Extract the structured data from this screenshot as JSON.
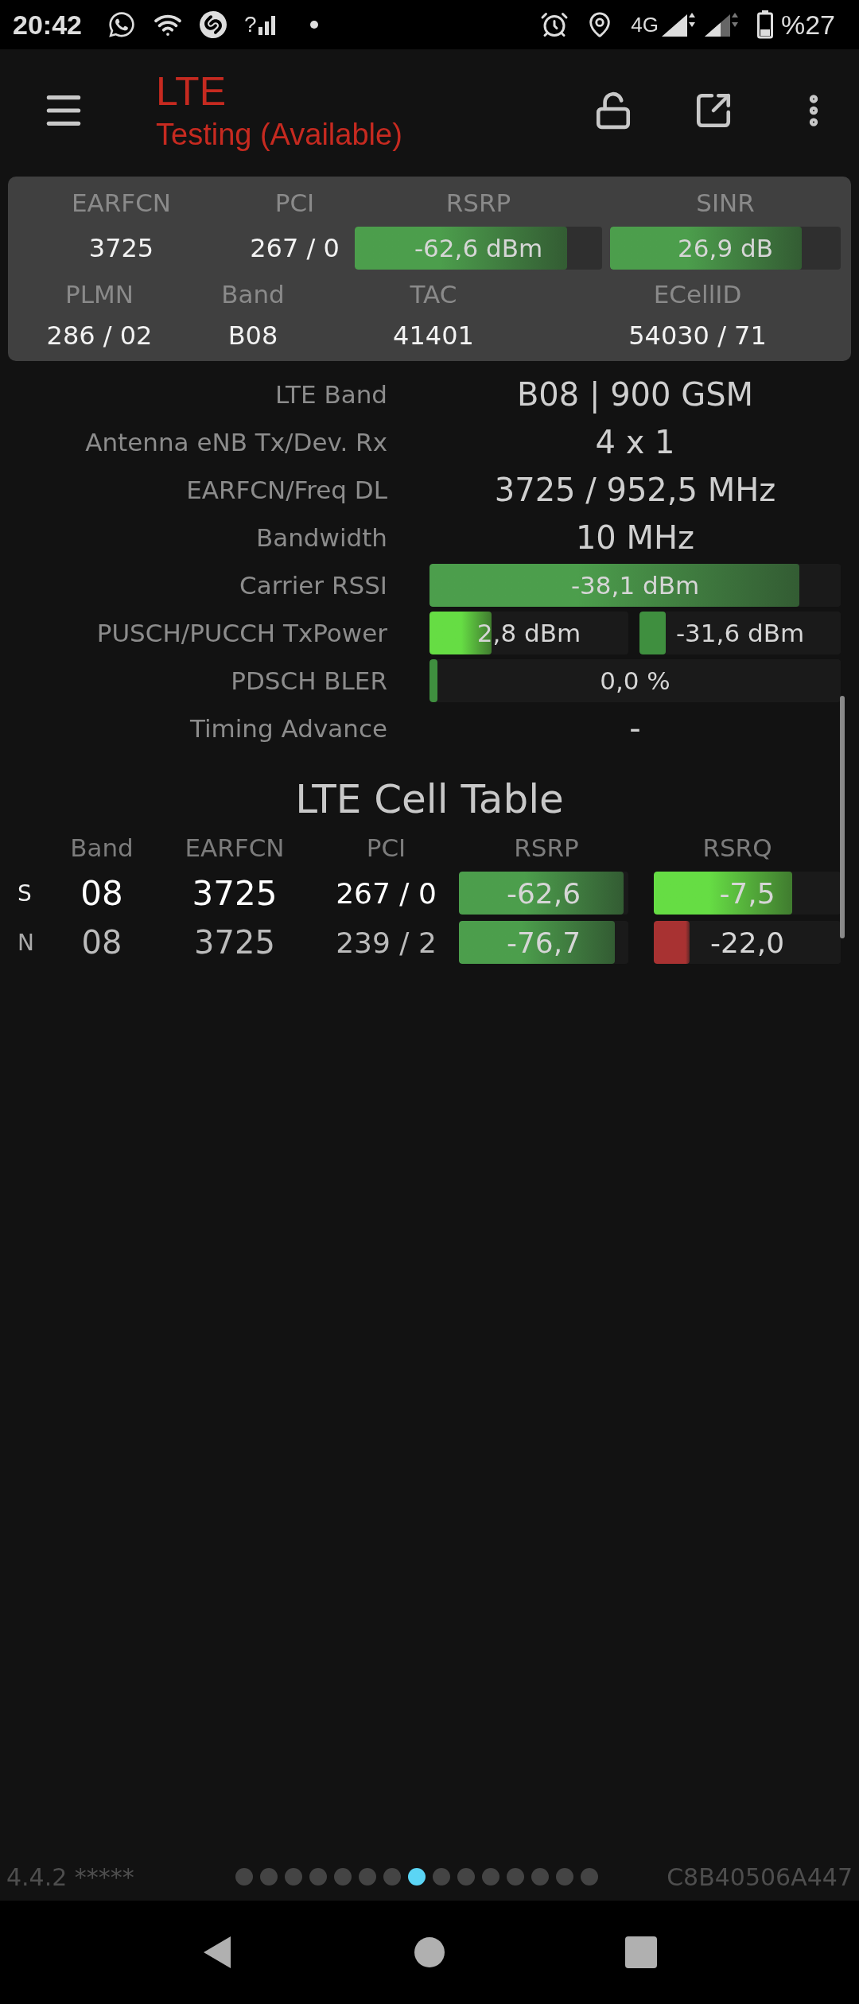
{
  "status_bar": {
    "time": "20:42",
    "unknown_signal": "?",
    "network": "4G",
    "battery": "%27"
  },
  "app_bar": {
    "title": "LTE",
    "subtitle": "Testing (Available)"
  },
  "summary": {
    "row_1": [
      {
        "label": "EARFCN",
        "kind": "text",
        "value": "3725"
      },
      {
        "label": "PCI",
        "kind": "text",
        "value": "267 / 0"
      },
      {
        "label": "RSRP",
        "kind": "bar",
        "value": "-62,6 dBm",
        "level": 0.86,
        "color": "#4c9e4c"
      },
      {
        "label": "SINR",
        "kind": "bar",
        "value": "26,9 dB",
        "level": 0.83,
        "color": "#4c9e4c"
      }
    ],
    "row_2": [
      {
        "label": "PLMN",
        "kind": "text",
        "value": "286 / 02"
      },
      {
        "label": "Band",
        "kind": "text",
        "value": "B08"
      },
      {
        "label": "TAC",
        "kind": "text",
        "value": "41401"
      },
      {
        "label": "ECellID",
        "kind": "text",
        "value": "54030 / 71"
      }
    ]
  },
  "details": [
    {
      "label": "LTE Band",
      "kind": "text",
      "value": "B08 | 900 GSM"
    },
    {
      "label": "Antenna eNB Tx/Dev. Rx",
      "kind": "text",
      "value": "4 x 1"
    },
    {
      "label": "EARFCN/Freq DL",
      "kind": "text",
      "value": "3725 / 952,5 MHz"
    },
    {
      "label": "Bandwidth",
      "kind": "text",
      "value": "10 MHz"
    },
    {
      "label": "Carrier RSSI",
      "kind": "bar",
      "bars": [
        {
          "value": "-38,1 dBm",
          "level": 0.9,
          "color": "#4c9e4c"
        }
      ]
    },
    {
      "label": "PUSCH/PUCCH TxPower",
      "kind": "bar",
      "bars": [
        {
          "value": "2,8 dBm",
          "level": 0.31,
          "color": "#66dd44"
        },
        {
          "value": "-31,6 dBm",
          "level": 0.13,
          "color": "#3f8f3f"
        }
      ]
    },
    {
      "label": "PDSCH BLER",
      "kind": "bar",
      "bars": [
        {
          "value": "0,0 %",
          "level": 0.02,
          "color": "#3f8f3f"
        }
      ]
    },
    {
      "label": "Timing Advance",
      "kind": "text",
      "value": "-"
    }
  ],
  "cell_table": {
    "title": "LTE Cell Table",
    "columns": [
      "Band",
      "EARFCN",
      "PCI",
      "RSRP",
      "RSRQ"
    ],
    "rows": [
      {
        "type": "S",
        "serving": true,
        "band": "08",
        "earfcn": "3725",
        "pci": "267 / 0",
        "rsrp": {
          "value": "-62,6",
          "level": 0.97,
          "color": "#4c9e4c"
        },
        "rsrq": {
          "value": "-7,5",
          "level": 0.74,
          "color": "#66dd44"
        }
      },
      {
        "type": "N",
        "serving": false,
        "band": "08",
        "earfcn": "3725",
        "pci": "239 / 2",
        "rsrp": {
          "value": "-76,7",
          "level": 0.92,
          "color": "#4c9e4c"
        },
        "rsrq": {
          "value": "-22,0",
          "level": 0.19,
          "color": "#a83232"
        }
      }
    ]
  },
  "footer": {
    "version": "4.4.2 *****",
    "pages": [
      {
        "selected": false
      },
      {
        "selected": false
      },
      {
        "selected": false
      },
      {
        "selected": false
      },
      {
        "selected": false
      },
      {
        "selected": false
      },
      {
        "selected": false
      },
      {
        "selected": true
      },
      {
        "selected": false
      },
      {
        "selected": false
      },
      {
        "selected": false
      },
      {
        "selected": false
      },
      {
        "selected": false
      },
      {
        "selected": false
      },
      {
        "selected": false
      }
    ],
    "device_id": "C8B40506A447"
  }
}
